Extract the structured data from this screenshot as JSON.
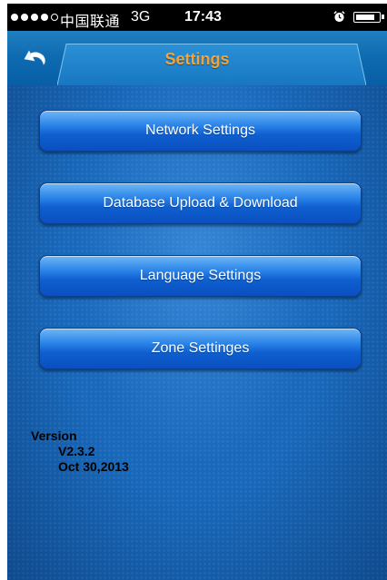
{
  "status_bar": {
    "carrier": "中国联通",
    "network_type": "3G",
    "time": "17:43",
    "signal_bars_filled": 4,
    "signal_bars_total": 5
  },
  "nav": {
    "title": "Settings",
    "back_icon": "back-arrow-icon",
    "title_color": "#f2a43a"
  },
  "menu": {
    "network_settings": "Network Settings",
    "database": "Database Upload & Download",
    "language_settings": "Language Settings",
    "zone_settings": "Zone Settinges"
  },
  "version": {
    "label": "Version",
    "number": "V2.3.2",
    "date": "Oct 30,2013"
  },
  "colors": {
    "accent": "#1767b9",
    "button": "#2d86e8"
  }
}
